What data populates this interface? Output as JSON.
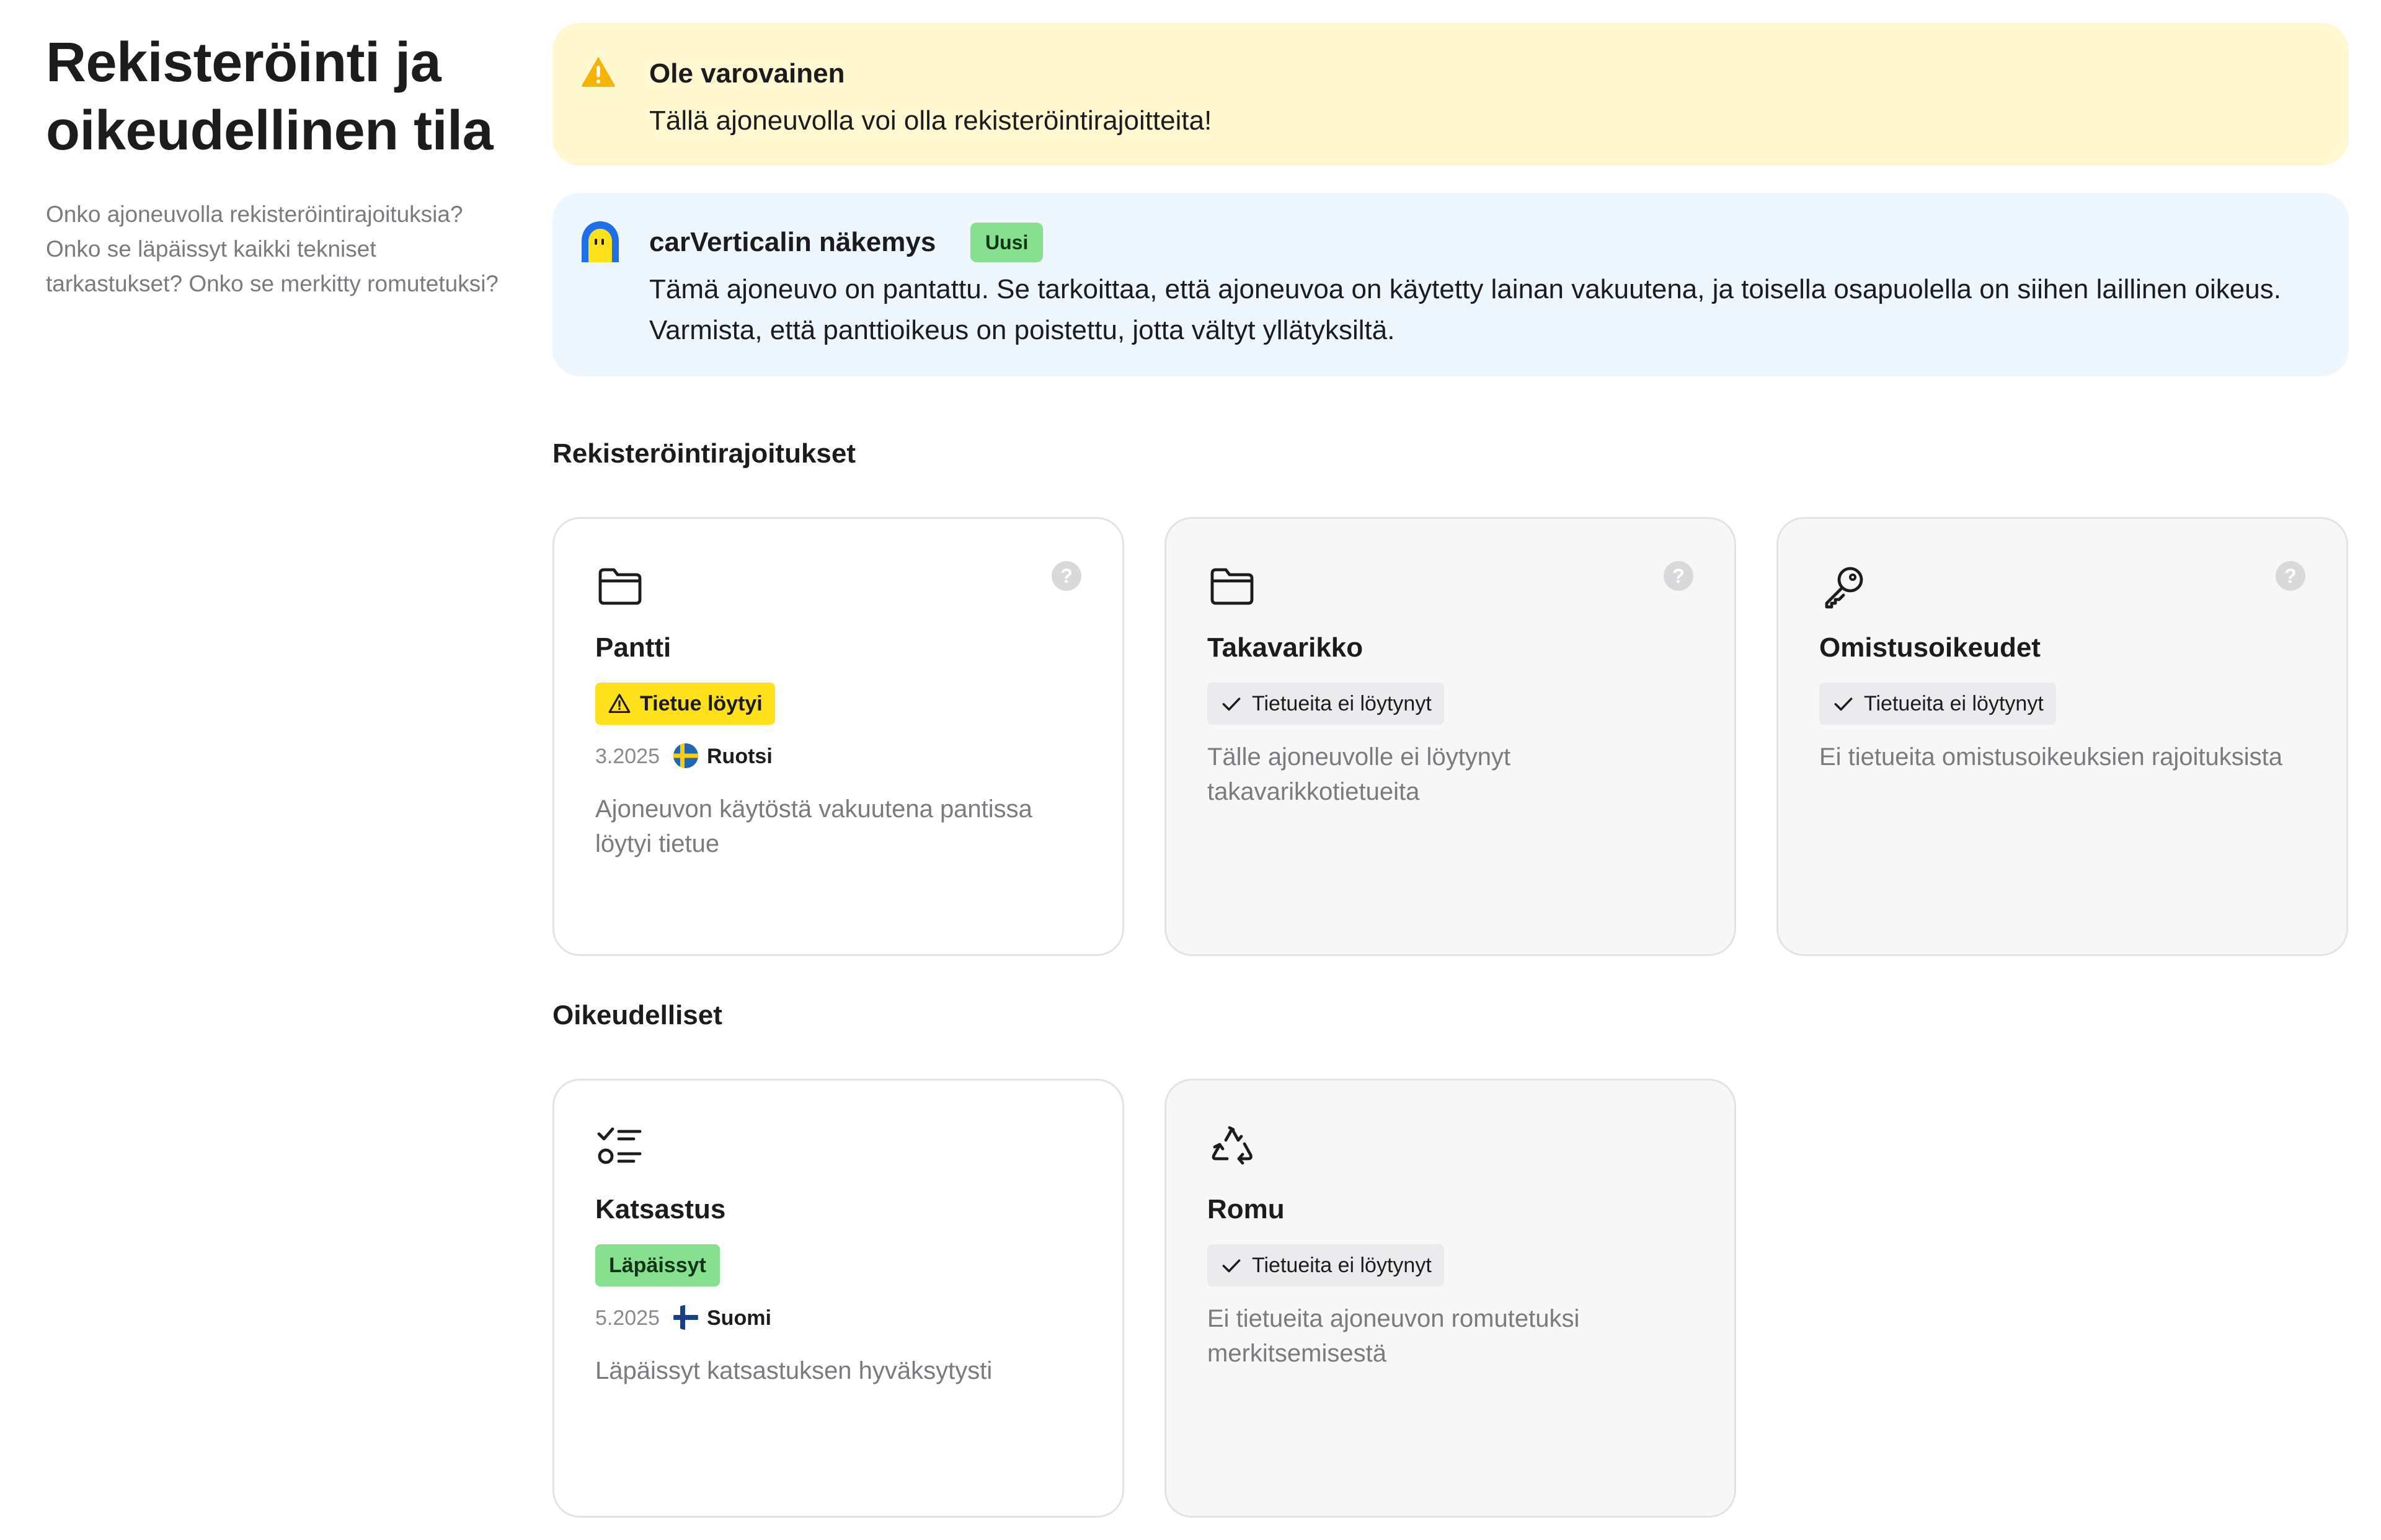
{
  "intro": {
    "title": "Rekisteröinti ja oikeudellinen tila",
    "description": "Onko ajoneuvolla rekisteröintirajoituksia? Onko se läpäissyt kaikki tekniset tarkastukset? Onko se merkitty romutetuksi?"
  },
  "warning_alert": {
    "title": "Ole varovainen",
    "text": "Tällä ajoneuvolla voi olla rekisteröintirajoitteita!",
    "icon": "warning-triangle-icon"
  },
  "insight_alert": {
    "title": "carVerticalin näkemys",
    "badge": "Uusi",
    "text": "Tämä ajoneuvo on pantattu. Se tarkoittaa, että ajoneuvoa on käytetty lainan vakuutena, ja toisella osapuolella on siihen laillinen oikeus. Varmista, että panttioikeus on poistettu, jotta vältyt yllätyksiltä.",
    "icon": "carvertical-mascot-icon"
  },
  "sections": {
    "restrictions_title": "Rekisteröintirajoitukset",
    "legal_title": "Oikeudelliset"
  },
  "cards": {
    "pantti": {
      "title": "Pantti",
      "status": "Tietue löytyi",
      "date": "3.2025",
      "country": "Ruotsi",
      "description": "Ajoneuvon käytöstä vakuutena pantissa löytyi tietue",
      "icon": "folder-icon",
      "help": "?"
    },
    "takavarikko": {
      "title": "Takavarikko",
      "status": "Tietueita ei löytynyt",
      "description": "Tälle ajoneuvolle ei löytynyt takavarikkotietueita",
      "icon": "folder-icon",
      "help": "?"
    },
    "omistusoikeudet": {
      "title": "Omistusoikeudet",
      "status": "Tietueita ei löytynyt",
      "description": "Ei tietueita omistusoikeuksien rajoituksista",
      "icon": "key-icon",
      "help": "?"
    },
    "katsastus": {
      "title": "Katsastus",
      "status": "Läpäissyt",
      "date": "5.2025",
      "country": "Suomi",
      "description": "Läpäissyt katsastuksen hyväksytysti",
      "icon": "checklist-icon"
    },
    "romu": {
      "title": "Romu",
      "status": "Tietueita ei löytynyt",
      "description": "Ei tietueita ajoneuvon romutetuksi merkitsemisestä",
      "icon": "recycle-icon"
    }
  },
  "colors": {
    "warning_bg": "#fff8d1",
    "insight_bg": "#eef6fe",
    "found_badge": "#ffe11b",
    "passed_badge": "#86e08f",
    "new_badge": "#86e08f"
  }
}
